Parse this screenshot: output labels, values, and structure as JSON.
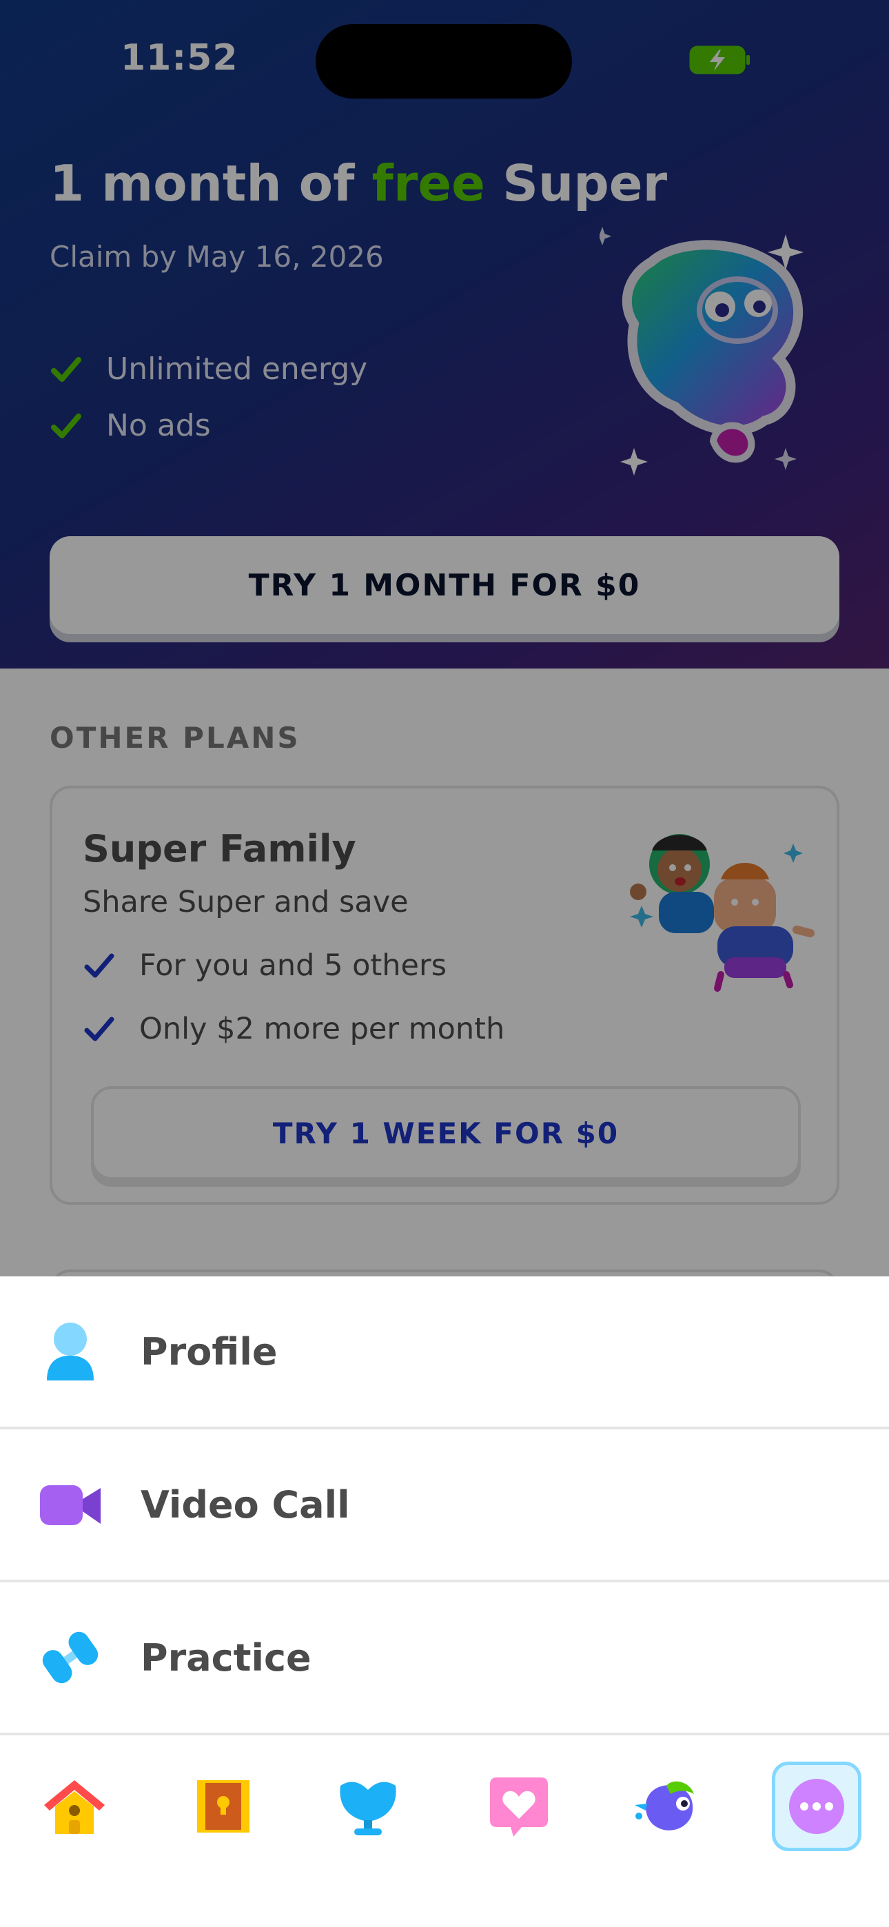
{
  "status_bar": {
    "time": "11:52"
  },
  "hero": {
    "title_prefix": "1 month of ",
    "title_highlight": "free",
    "title_suffix": " Super",
    "subtitle": "Claim by May 16, 2026",
    "benefits": [
      "Unlimited energy",
      "No ads"
    ],
    "cta": "TRY 1 MONTH FOR $0"
  },
  "other_plans": {
    "heading": "OTHER PLANS",
    "family": {
      "title": "Super Family",
      "subtitle": "Share Super and save",
      "features": [
        "For you and 5 others",
        "Only $2 more per month"
      ],
      "cta": "TRY 1 WEEK FOR $0"
    }
  },
  "menu": {
    "items": [
      {
        "label": "Profile",
        "icon": "profile-icon"
      },
      {
        "label": "Video Call",
        "icon": "video-camera-icon"
      },
      {
        "label": "Practice",
        "icon": "dumbbell-icon"
      }
    ]
  },
  "tabs": [
    {
      "icon": "home-icon"
    },
    {
      "icon": "treasure-chest-icon"
    },
    {
      "icon": "shield-trophy-icon"
    },
    {
      "icon": "heart-chat-icon"
    },
    {
      "icon": "bird-icon"
    },
    {
      "icon": "more-icon",
      "active": true
    }
  ],
  "colors": {
    "brand_green": "#58cc02",
    "hero_gradient_start": "#123a86",
    "hero_gradient_end": "#532470",
    "link_blue": "#1e36c9",
    "active_tab_bg": "#ddf4ff",
    "active_tab_border": "#84d8ff"
  }
}
